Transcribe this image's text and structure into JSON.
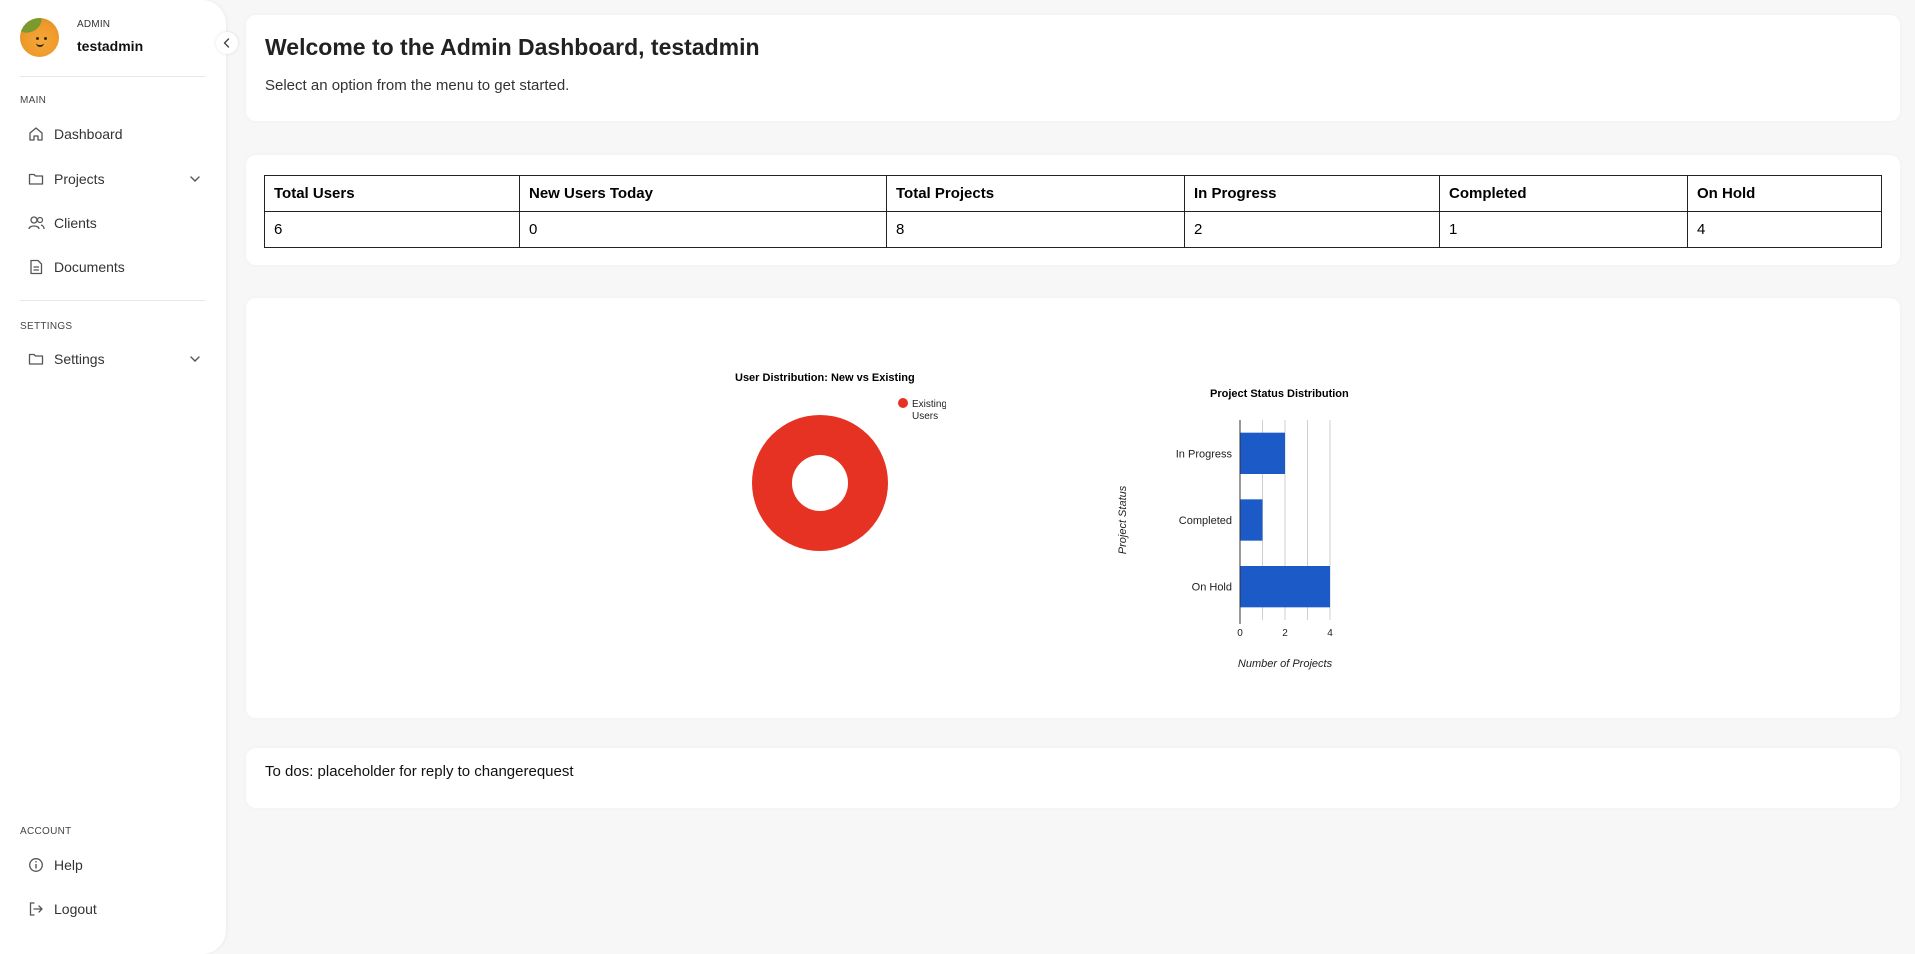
{
  "sidebar": {
    "user": {
      "role": "ADMIN",
      "name": "testadmin"
    },
    "sections": {
      "main": "MAIN",
      "settings": "SETTINGS",
      "account": "ACCOUNT"
    },
    "items": {
      "dashboard": "Dashboard",
      "projects": "Projects",
      "clients": "Clients",
      "documents": "Documents",
      "settings": "Settings",
      "help": "Help",
      "logout": "Logout"
    }
  },
  "welcome": {
    "title": "Welcome to the Admin Dashboard, testadmin",
    "subtitle": "Select an option from the menu to get started."
  },
  "stats": {
    "headers": [
      "Total Users",
      "New Users Today",
      "Total Projects",
      "In Progress",
      "Completed",
      "On Hold"
    ],
    "values": [
      "6",
      "0",
      "8",
      "2",
      "1",
      "4"
    ]
  },
  "chart_data": [
    {
      "type": "pie",
      "title": "User Distribution: New vs Existing",
      "categories": [
        "Existing Users"
      ],
      "values": [
        6
      ],
      "colors": [
        "#e63222"
      ],
      "legend_position": "right",
      "donut": true
    },
    {
      "type": "bar",
      "orientation": "horizontal",
      "title": "Project Status Distribution",
      "categories": [
        "In Progress",
        "Completed",
        "On Hold"
      ],
      "values": [
        2,
        1,
        4
      ],
      "xlabel": "Number of Projects",
      "ylabel": "Project Status",
      "xlim": [
        0,
        4
      ],
      "xticks": [
        "0",
        "2",
        "4"
      ],
      "grid": true,
      "color": "#1c5ac8"
    }
  ],
  "todo": {
    "text": "To dos: placeholder for reply to changerequest"
  },
  "colors": {
    "accent": "#1c5ac8",
    "pie": "#e63222",
    "background": "#f7f7f8"
  }
}
